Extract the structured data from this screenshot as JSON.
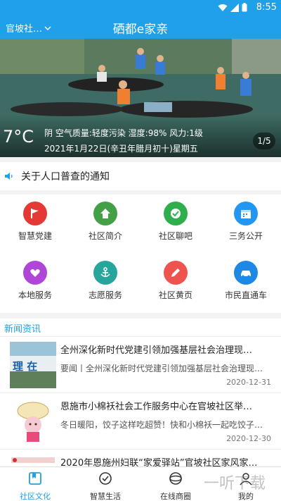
{
  "status_bar": {
    "time": "8:55"
  },
  "app_bar": {
    "location": "官坡社…",
    "title": "硒都e家亲"
  },
  "banner": {
    "temperature": "7°C",
    "weather": "阴 空气质量:轻度污染 湿度:98% 风力:1级",
    "date": "2021年1月22日(辛丑年腊月初十)星期五",
    "pager": "1/5"
  },
  "notice": {
    "text": "关于人口普查的通知"
  },
  "services": [
    {
      "label": "智慧党建",
      "icon": "party-flag-icon",
      "color": "#e53935"
    },
    {
      "label": "社区简介",
      "icon": "home-icon",
      "color": "#43a047"
    },
    {
      "label": "社区聊吧",
      "icon": "chat-check-icon",
      "color": "#2fae4e"
    },
    {
      "label": "三务公开",
      "icon": "calendar-icon",
      "color": "#2196f3"
    },
    {
      "label": "本地服务",
      "icon": "heart-hand-icon",
      "color": "#b046d8"
    },
    {
      "label": "志愿服务",
      "icon": "anchor-icon",
      "color": "#26a69a"
    },
    {
      "label": "社区黄页",
      "icon": "pen-icon",
      "color": "#ef5350"
    },
    {
      "label": "市民直通车",
      "icon": "car-icon",
      "color": "#1e88e5"
    }
  ],
  "news": {
    "header": "新闻资讯",
    "items": [
      {
        "title": "全州深化新时代党建引领加强基层社会治理现…",
        "summary": "要闻丨全州深化新时代党建引领加强基层社会治理现…",
        "date": "2020-12-31",
        "thumb_text": "理 在"
      },
      {
        "title": "恩施市小棉袄社会工作服务中心在官坡社区举…",
        "summary": "冬日暖阳，饺子这样吃超赞！快和小棉袄一起吃饺子…",
        "date": "2020-12-30"
      },
      {
        "title": "2020年恩施州妇联“家爱驿站”官坡社区家风家…",
        "summary": "",
        "date": ""
      }
    ]
  },
  "tabs": [
    {
      "label": "社区文化",
      "icon": "book-icon",
      "active": true
    },
    {
      "label": "智慧生活",
      "icon": "shield-check-icon",
      "active": false
    },
    {
      "label": "在线商圈",
      "icon": "globe-icon",
      "active": false
    },
    {
      "label": "我的",
      "icon": "user-icon",
      "active": false
    }
  ],
  "watermark": "一听下载"
}
